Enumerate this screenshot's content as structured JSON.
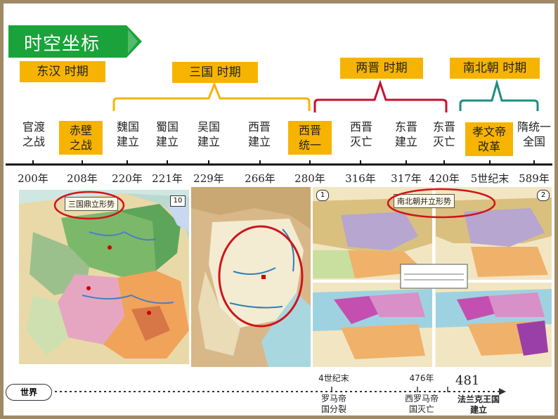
{
  "header": {
    "title": "时空坐标"
  },
  "periods": [
    {
      "label": "东汉   时期",
      "style": "box",
      "color": "#f6b400"
    },
    {
      "label": "三国   时期",
      "style": "box",
      "color": "#f6b400"
    },
    {
      "label": "两晋   时期",
      "style": "box",
      "color": "#f6b400"
    },
    {
      "label": "南北朝 时期",
      "style": "box",
      "color": "#f6b400"
    }
  ],
  "events": [
    {
      "line1": "官渡",
      "line2": "之战",
      "highlight": false
    },
    {
      "line1": "赤壁",
      "line2": "之战",
      "highlight": true
    },
    {
      "line1": "魏国",
      "line2": "建立",
      "highlight": false
    },
    {
      "line1": "蜀国",
      "line2": "建立",
      "highlight": false
    },
    {
      "line1": "吴国",
      "line2": "建立",
      "highlight": false
    },
    {
      "line1": "西晋",
      "line2": "建立",
      "highlight": false
    },
    {
      "line1": "西晋",
      "line2": "统一",
      "highlight": true
    },
    {
      "line1": "西晋",
      "line2": "灭亡",
      "highlight": false
    },
    {
      "line1": "东晋",
      "line2": "建立",
      "highlight": false
    },
    {
      "line1": "东晋",
      "line2": "灭亡",
      "highlight": false
    },
    {
      "line1": "孝文帝",
      "line2": "改革",
      "highlight": true
    },
    {
      "line1": "隋统一",
      "line2": "全国",
      "highlight": false
    }
  ],
  "years": [
    "200年",
    "208年",
    "220年",
    "221年",
    "229年",
    "266年",
    "280年",
    "316年",
    "317年",
    "420年",
    "5世纪末",
    "589年"
  ],
  "maps": {
    "left_label": "三国鼎立形势",
    "left_badge": "10",
    "right_label": "南北朝并立形势",
    "right_badge1": "1",
    "right_badge2": "2"
  },
  "world": {
    "label": "世界",
    "e1_top": "4世纪末",
    "e1_bottom_1": "罗马帝",
    "e1_bottom_2": "国分裂",
    "e2_top": "476年",
    "e2_bottom_1": "西罗马帝",
    "e2_bottom_2": "国灭亡",
    "e3_top": "481",
    "e3_bottom_1": "法兰克王国",
    "e3_bottom_2": "建立"
  },
  "colors": {
    "green": "#1aa33a",
    "gold": "#f6b400",
    "red_bracket": "#c8102e",
    "teal_bracket": "#1a8f80",
    "frame": "#a08a66"
  }
}
